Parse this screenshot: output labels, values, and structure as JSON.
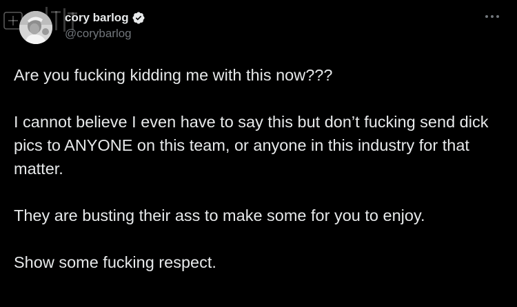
{
  "tweet": {
    "author": {
      "display_name": "cory barlog",
      "handle": "@corybarlog",
      "verified": true,
      "avatar_icon": "profile-photo-avatar"
    },
    "menu_icon": "more-options-icon",
    "watermark_text": "游研社",
    "paragraphs": [
      "Are you fucking kidding me with this now???",
      "I cannot believe I even have to say this but don’t fucking send dick pics to ANYONE on this team, or anyone in this industry for that matter.",
      "They are busting their ass to make some for you to enjoy.",
      "Show some fucking respect."
    ]
  },
  "colors": {
    "background": "#000000",
    "text": "#e7e9ea",
    "secondary_text": "#71767b",
    "verified_badge": "#e7e9ea"
  }
}
